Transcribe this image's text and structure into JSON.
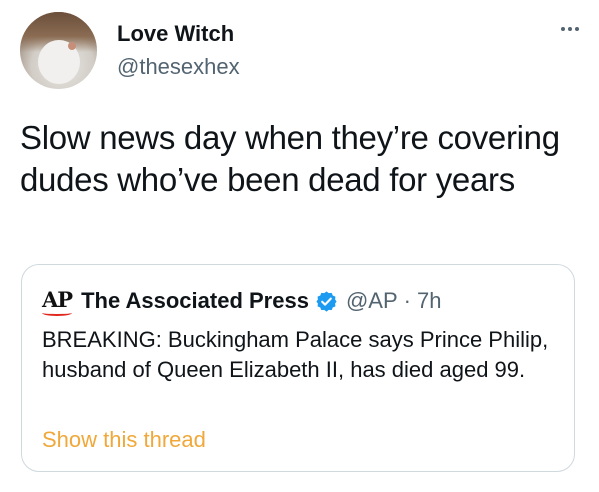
{
  "tweet": {
    "author": {
      "name": "Love Witch",
      "handle": "@thesexhex"
    },
    "text": "Slow news day when they’re covering dudes who’ve been dead for years",
    "more_icon": "ellipsis-icon"
  },
  "quoted_tweet": {
    "logo_text": "AP",
    "author_name": "The Associated Press",
    "verified_icon": "verified-badge-icon",
    "handle": "@AP",
    "separator": "·",
    "time": "7h",
    "text": "BREAKING: Buckingham Palace says Prince Philip, husband of Queen Elizabeth II, has died aged 99.",
    "show_thread_label": "Show this thread"
  },
  "colors": {
    "text": "#0f1419",
    "secondary": "#536471",
    "border": "#cfd9de",
    "verified": "#1d9bf0",
    "link": "#f0a83a",
    "ap_red": "#e0281e"
  }
}
